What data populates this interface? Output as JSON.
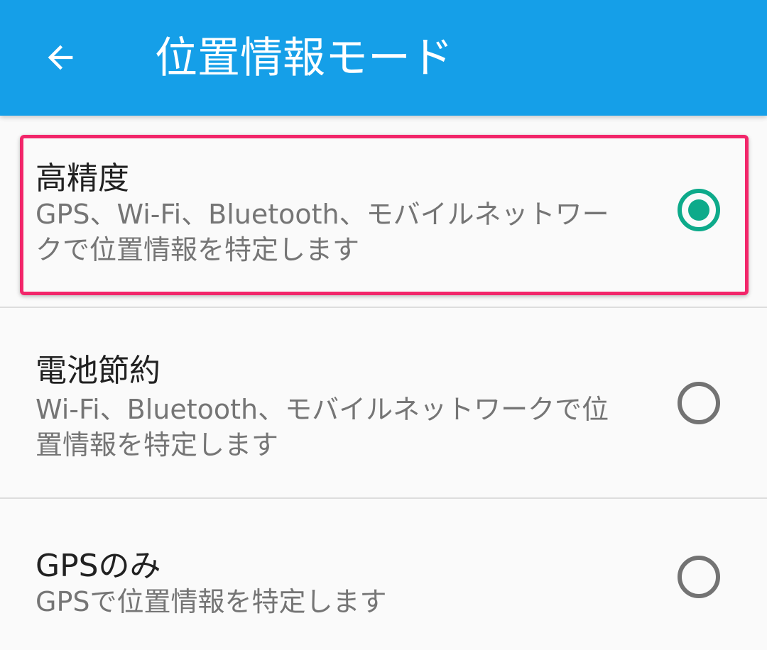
{
  "appbar": {
    "title": "位置情報モード",
    "back_icon": "arrow-back-icon",
    "color": "#159fe8"
  },
  "options": [
    {
      "title": "高精度",
      "summary": "GPS、Wi-Fi、Bluetooth、モバイルネットワークで位置情報を特定します",
      "selected": true
    },
    {
      "title": "電池節約",
      "summary": "Wi-Fi、Bluetooth、モバイルネットワークで位置情報を特定します",
      "selected": false
    },
    {
      "title": "GPSのみ",
      "summary": "GPSで位置情報を特定します",
      "selected": false
    }
  ],
  "colors": {
    "accent": "#0daa8a",
    "highlight": "#f2266a"
  }
}
